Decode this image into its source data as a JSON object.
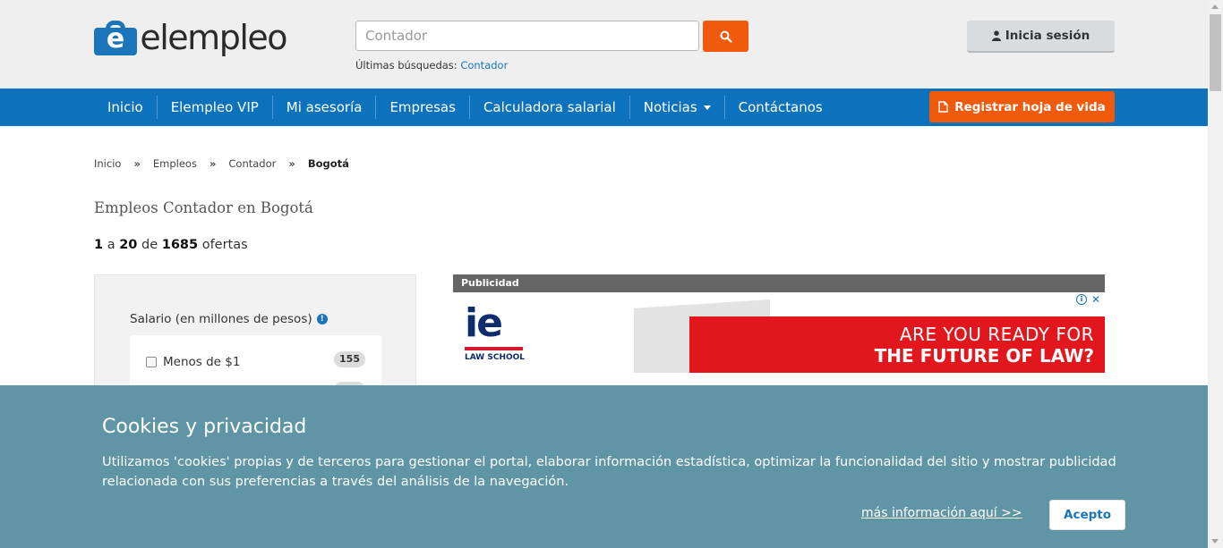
{
  "header": {
    "logo_text": "elempleo",
    "search_placeholder": "Contador",
    "recent_label": "Últimas búsquedas:",
    "recent_link": "Contador",
    "login_label": "Inicia sesión"
  },
  "nav": {
    "items": [
      "Inicio",
      "Elempleo VIP",
      "Mi asesoría",
      "Empresas",
      "Calculadora salarial",
      "Noticias",
      "Contáctanos"
    ],
    "register_label": "Registrar hoja de vida"
  },
  "breadcrumb": {
    "items": [
      "Inicio",
      "Empleos",
      "Contador"
    ],
    "separator": "»",
    "current": "Bogotá"
  },
  "main": {
    "title": "Empleos Contador en Bogotá",
    "count_from": "1",
    "count_a": "a",
    "count_to": "20",
    "count_de": "de",
    "count_total": "1685",
    "count_suffix": "ofertas"
  },
  "filter": {
    "title": "Salario (en millones de pesos)",
    "option_label": "Menos de $1",
    "option_count": "155"
  },
  "ad": {
    "label": "Publicidad",
    "brand": "ie",
    "brand_sub": "LAW SCHOOL",
    "line1": "ARE YOU READY FOR",
    "line2": "THE FUTURE OF LAW?"
  },
  "cookie": {
    "title": "Cookies y privacidad",
    "text": "Utilizamos 'cookies' propias y de terceros para gestionar el portal, elaborar información estadística, optimizar la funcionalidad del sitio y mostrar publicidad relacionada con sus preferencias a través del análisis de la navegación.",
    "link": "más información aquí >>",
    "accept": "Acepto"
  },
  "colors": {
    "brand_blue": "#0d72bc",
    "accent_orange": "#f05a0d",
    "cookie_bg": "#5f95a4"
  }
}
